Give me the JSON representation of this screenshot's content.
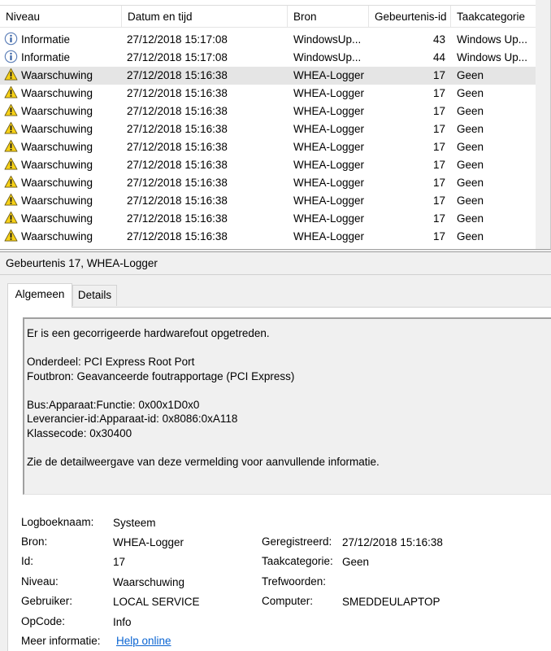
{
  "columns": {
    "niveau": "Niveau",
    "datum": "Datum en tijd",
    "bron": "Bron",
    "id": "Gebeurtenis-id",
    "taak": "Taakcategorie"
  },
  "rows": [
    {
      "level_icon": "info-icon",
      "niveau": "Informatie",
      "datum": "27/12/2018 15:17:08",
      "bron": "WindowsUp...",
      "id": "43",
      "taak": "Windows Up..."
    },
    {
      "level_icon": "info-icon",
      "niveau": "Informatie",
      "datum": "27/12/2018 15:17:08",
      "bron": "WindowsUp...",
      "id": "44",
      "taak": "Windows Up..."
    },
    {
      "level_icon": "warning-icon",
      "niveau": "Waarschuwing",
      "datum": "27/12/2018 15:16:38",
      "bron": "WHEA-Logger",
      "id": "17",
      "taak": "Geen",
      "selected": true
    },
    {
      "level_icon": "warning-icon",
      "niveau": "Waarschuwing",
      "datum": "27/12/2018 15:16:38",
      "bron": "WHEA-Logger",
      "id": "17",
      "taak": "Geen"
    },
    {
      "level_icon": "warning-icon",
      "niveau": "Waarschuwing",
      "datum": "27/12/2018 15:16:38",
      "bron": "WHEA-Logger",
      "id": "17",
      "taak": "Geen"
    },
    {
      "level_icon": "warning-icon",
      "niveau": "Waarschuwing",
      "datum": "27/12/2018 15:16:38",
      "bron": "WHEA-Logger",
      "id": "17",
      "taak": "Geen"
    },
    {
      "level_icon": "warning-icon",
      "niveau": "Waarschuwing",
      "datum": "27/12/2018 15:16:38",
      "bron": "WHEA-Logger",
      "id": "17",
      "taak": "Geen"
    },
    {
      "level_icon": "warning-icon",
      "niveau": "Waarschuwing",
      "datum": "27/12/2018 15:16:38",
      "bron": "WHEA-Logger",
      "id": "17",
      "taak": "Geen"
    },
    {
      "level_icon": "warning-icon",
      "niveau": "Waarschuwing",
      "datum": "27/12/2018 15:16:38",
      "bron": "WHEA-Logger",
      "id": "17",
      "taak": "Geen"
    },
    {
      "level_icon": "warning-icon",
      "niveau": "Waarschuwing",
      "datum": "27/12/2018 15:16:38",
      "bron": "WHEA-Logger",
      "id": "17",
      "taak": "Geen"
    },
    {
      "level_icon": "warning-icon",
      "niveau": "Waarschuwing",
      "datum": "27/12/2018 15:16:38",
      "bron": "WHEA-Logger",
      "id": "17",
      "taak": "Geen"
    },
    {
      "level_icon": "warning-icon",
      "niveau": "Waarschuwing",
      "datum": "27/12/2018 15:16:38",
      "bron": "WHEA-Logger",
      "id": "17",
      "taak": "Geen"
    }
  ],
  "detail": {
    "title": "Gebeurtenis 17, WHEA-Logger",
    "tabs": {
      "general": "Algemeen",
      "details": "Details"
    },
    "description": {
      "line1": "Er is een gecorrigeerde hardwarefout opgetreden.",
      "line2": "Onderdeel: PCI Express Root Port",
      "line3": "Foutbron: Geavanceerde foutrapportage (PCI Express)",
      "line4": "Bus:Apparaat:Functie: 0x00x1D0x0",
      "line5": "Leverancier-id:Apparaat-id: 0x8086:0xA118",
      "line6": "Klassecode: 0x30400",
      "line7": "Zie de detailweergave van deze vermelding voor aanvullende informatie."
    },
    "props": {
      "logboeknaam_label": "Logboeknaam:",
      "logboeknaam": "Systeem",
      "bron_label": "Bron:",
      "bron": "WHEA-Logger",
      "geregistreerd_label": "Geregistreerd:",
      "geregistreerd": "27/12/2018 15:16:38",
      "id_label": "Id:",
      "id": "17",
      "taak_label": "Taakcategorie:",
      "taak": "Geen",
      "niveau_label": "Niveau:",
      "niveau": "Waarschuwing",
      "trefwoorden_label": "Trefwoorden:",
      "trefwoorden": "",
      "gebruiker_label": "Gebruiker:",
      "gebruiker": "LOCAL SERVICE",
      "computer_label": "Computer:",
      "computer": "SMEDDEULAPTOP",
      "opcode_label": "OpCode:",
      "opcode": "Info",
      "meer_label": "Meer informatie:",
      "meer_link": "Help online"
    }
  },
  "colors": {
    "link": "#0a64d2",
    "warning": "#f7d117",
    "info": "#3a7bd5",
    "selection": "#e5e5e5"
  }
}
